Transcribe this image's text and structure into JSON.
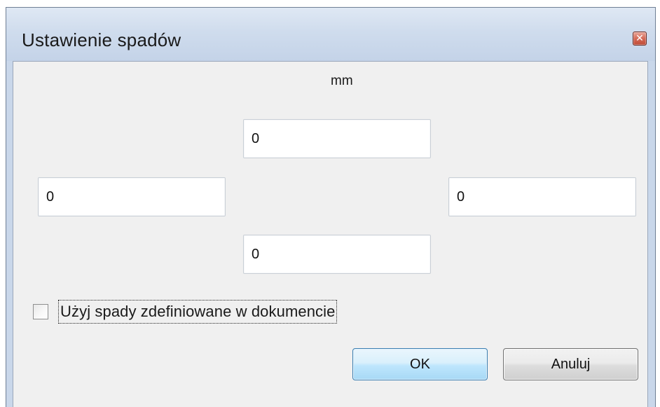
{
  "dialog": {
    "title": "Ustawienie spadów",
    "close_icon": "close-icon"
  },
  "bleed": {
    "unit": "mm",
    "top": "0",
    "left": "0",
    "right": "0",
    "bottom": "0"
  },
  "use_document_bleed": {
    "label": "Użyj spady zdefiniowane w dokumencie",
    "checked": false
  },
  "buttons": {
    "ok_label": "OK",
    "cancel_label": "Anuluj"
  },
  "colors": {
    "title_bar": "#c9d7ea",
    "client_bg": "#f0f0f0",
    "close_button": "#c75a45",
    "ok_border": "#3c7fb1"
  }
}
